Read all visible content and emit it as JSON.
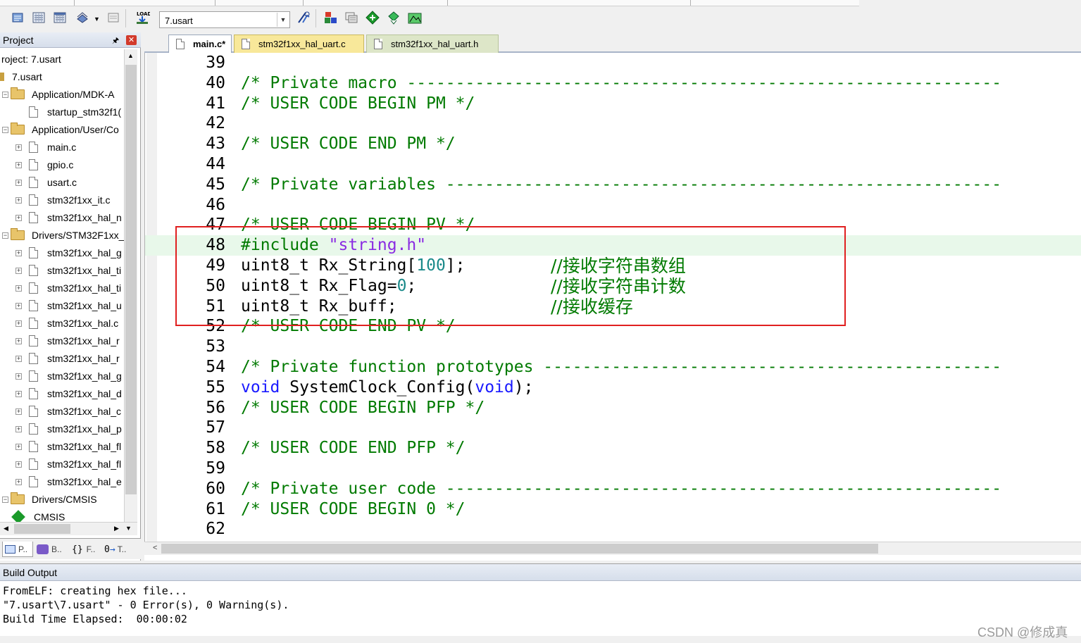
{
  "toolbar": {
    "target_name": "7.usart",
    "icons": [
      "translate-icon",
      "build-icon",
      "rebuild-icon",
      "batch-build-icon",
      "stop-build-icon",
      "download-icon",
      "target-options-icon",
      "manage-components-icon",
      "select-software-packs-icon",
      "pack-installer-icon",
      "debug-icon",
      "run-icon"
    ]
  },
  "project_panel": {
    "title": "Project",
    "project_label": "roject: 7.usart",
    "target_label": "7.usart",
    "tree": [
      {
        "label": "Application/MDK-A",
        "type": "folder",
        "indent": 0
      },
      {
        "label": "startup_stm32f1(",
        "type": "file",
        "indent": 1,
        "expandable": false
      },
      {
        "label": "Application/User/Co",
        "type": "folder",
        "indent": 0
      },
      {
        "label": "main.c",
        "type": "file",
        "indent": 1,
        "expandable": true
      },
      {
        "label": "gpio.c",
        "type": "file",
        "indent": 1,
        "expandable": true
      },
      {
        "label": "usart.c",
        "type": "file",
        "indent": 1,
        "expandable": true
      },
      {
        "label": "stm32f1xx_it.c",
        "type": "file",
        "indent": 1,
        "expandable": true
      },
      {
        "label": "stm32f1xx_hal_n",
        "type": "file",
        "indent": 1,
        "expandable": true
      },
      {
        "label": "Drivers/STM32F1xx_",
        "type": "folder",
        "indent": 0
      },
      {
        "label": "stm32f1xx_hal_g",
        "type": "file",
        "indent": 1,
        "expandable": true
      },
      {
        "label": "stm32f1xx_hal_ti",
        "type": "file",
        "indent": 1,
        "expandable": true
      },
      {
        "label": "stm32f1xx_hal_ti",
        "type": "file",
        "indent": 1,
        "expandable": true
      },
      {
        "label": "stm32f1xx_hal_u",
        "type": "file",
        "indent": 1,
        "expandable": true
      },
      {
        "label": "stm32f1xx_hal.c",
        "type": "file",
        "indent": 1,
        "expandable": true
      },
      {
        "label": "stm32f1xx_hal_r",
        "type": "file",
        "indent": 1,
        "expandable": true
      },
      {
        "label": "stm32f1xx_hal_r",
        "type": "file",
        "indent": 1,
        "expandable": true
      },
      {
        "label": "stm32f1xx_hal_g",
        "type": "file",
        "indent": 1,
        "expandable": true
      },
      {
        "label": "stm32f1xx_hal_d",
        "type": "file",
        "indent": 1,
        "expandable": true
      },
      {
        "label": "stm32f1xx_hal_c",
        "type": "file",
        "indent": 1,
        "expandable": true
      },
      {
        "label": "stm32f1xx_hal_p",
        "type": "file",
        "indent": 1,
        "expandable": true
      },
      {
        "label": "stm32f1xx_hal_fl",
        "type": "file",
        "indent": 1,
        "expandable": true
      },
      {
        "label": "stm32f1xx_hal_fl",
        "type": "file",
        "indent": 1,
        "expandable": true
      },
      {
        "label": "stm32f1xx_hal_e",
        "type": "file",
        "indent": 1,
        "expandable": true
      },
      {
        "label": "Drivers/CMSIS",
        "type": "folder",
        "indent": 0
      },
      {
        "label": "CMSIS",
        "type": "component",
        "indent": 0
      }
    ],
    "tabs": [
      {
        "label": "P..",
        "icon": "project-tab-icon"
      },
      {
        "label": "B..",
        "icon": "books-tab-icon"
      },
      {
        "label": "F..",
        "icon": "functions-tab-icon"
      },
      {
        "label": "T..",
        "icon": "templates-tab-icon"
      }
    ]
  },
  "editor": {
    "tabs": [
      {
        "label": "main.c*",
        "state": "active"
      },
      {
        "label": "stm32f1xx_hal_uart.c",
        "state": "inactive"
      },
      {
        "label": "stm32f1xx_hal_uart.h",
        "state": "other"
      }
    ],
    "lines": [
      {
        "n": "39",
        "code": ""
      },
      {
        "n": "40",
        "code": "/* Private macro -------------------------------------------------------------"
      },
      {
        "n": "41",
        "code": "/* USER CODE BEGIN PM */"
      },
      {
        "n": "42",
        "code": ""
      },
      {
        "n": "43",
        "code": "/* USER CODE END PM */"
      },
      {
        "n": "44",
        "code": ""
      },
      {
        "n": "45",
        "code": "/* Private variables ---------------------------------------------------------"
      },
      {
        "n": "46",
        "code": ""
      },
      {
        "n": "47",
        "code": "/* USER CODE BEGIN PV */"
      },
      {
        "n": "48",
        "code": "#include \"string.h\""
      },
      {
        "n": "49",
        "code": "uint8_t Rx_String[100];",
        "comment": "//接收字符串数组"
      },
      {
        "n": "50",
        "code": "uint8_t Rx_Flag=0;",
        "comment": "//接收字符串计数"
      },
      {
        "n": "51",
        "code": "uint8_t Rx_buff;",
        "comment": "//接收缓存"
      },
      {
        "n": "52",
        "code": "/* USER CODE END PV */"
      },
      {
        "n": "53",
        "code": ""
      },
      {
        "n": "54",
        "code": "/* Private function prototypes -----------------------------------------------"
      },
      {
        "n": "55",
        "code": "void SystemClock_Config(void);"
      },
      {
        "n": "56",
        "code": "/* USER CODE BEGIN PFP */"
      },
      {
        "n": "57",
        "code": ""
      },
      {
        "n": "58",
        "code": "/* USER CODE END PFP */"
      },
      {
        "n": "59",
        "code": ""
      },
      {
        "n": "60",
        "code": "/* Private user code ---------------------------------------------------------"
      },
      {
        "n": "61",
        "code": "/* USER CODE BEGIN 0 */"
      },
      {
        "n": "62",
        "code": ""
      }
    ],
    "highlighted_line": "48"
  },
  "build_output": {
    "title": "Build Output",
    "lines": [
      "FromELF: creating hex file...",
      "\"7.usart\\7.usart\" - 0 Error(s), 0 Warning(s).",
      "Build Time Elapsed:  00:00:02"
    ]
  },
  "watermark": "CSDN @修成真",
  "colors": {
    "comment": "#007a00",
    "keyword": "#1a1aff",
    "string": "#8a2be2",
    "number": "#1a8a8a",
    "highlight_line": "#e8f8ea",
    "annotation_box": "#e02020"
  }
}
